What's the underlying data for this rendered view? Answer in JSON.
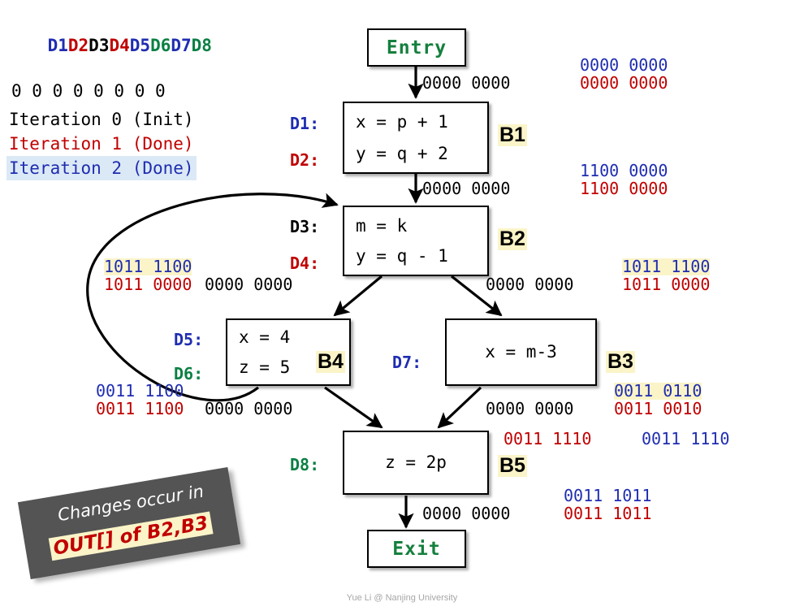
{
  "legend": {
    "definitions": [
      {
        "label": "D1",
        "color": "#1f2db0"
      },
      {
        "label": "D2",
        "color": "#c00000"
      },
      {
        "label": "D3",
        "color": "#000000"
      },
      {
        "label": "D4",
        "color": "#c00000"
      },
      {
        "label": "D5",
        "color": "#1f2db0"
      },
      {
        "label": "D6",
        "color": "#0a8043"
      },
      {
        "label": "D7",
        "color": "#1f2db0"
      },
      {
        "label": "D8",
        "color": "#0a8043"
      }
    ],
    "bits_row": "0 0 0 0 0 0 0 0",
    "iterations": [
      {
        "label": "Iteration 0 (Init)",
        "color": "#000000",
        "highlight": "none"
      },
      {
        "label": "Iteration 1 (Done)",
        "color": "#c00000",
        "highlight": "none"
      },
      {
        "label": "Iteration 2 (Done)",
        "color": "#1f2db0",
        "highlight": "#dbe9f6"
      }
    ]
  },
  "cfg": {
    "entry": {
      "label": "Entry"
    },
    "exit": {
      "label": "Exit"
    },
    "b1": {
      "name": "B1",
      "defs": [
        "D1:",
        "D2:"
      ],
      "stmts": [
        "x = p + 1",
        "y = q + 2"
      ]
    },
    "b2": {
      "name": "B2",
      "defs": [
        "D3:",
        "D4:"
      ],
      "stmts": [
        "m = k",
        "y = q - 1"
      ]
    },
    "b4": {
      "name": "B4",
      "defs": [
        "D5:",
        "D6:"
      ],
      "stmts": [
        "x = 4",
        "z = 5"
      ]
    },
    "b3": {
      "name": "B3",
      "defs": [
        "D7:"
      ],
      "stmts": [
        "x = m-3"
      ]
    },
    "b5": {
      "name": "B5",
      "defs": [
        "D8:"
      ],
      "stmts": [
        "z = 2p"
      ]
    }
  },
  "values": {
    "entry_out_black": "0000 0000",
    "entry_out_blue": "0000 0000",
    "entry_out_red": "0000 0000",
    "b1_out_black": "0000 0000",
    "b1_out_blue": "1100 0000",
    "b1_out_red": "1100 0000",
    "b2_in_left_blue": "1011 1100",
    "b2_in_left_red": "1011 0000",
    "b2_out_left_black": "0000 0000",
    "b2_out_right_black": "0000 0000",
    "b2_out_right_blue": "1011 1100",
    "b2_out_right_red": "1011 0000",
    "b4_out_blue": "0011 1100",
    "b4_out_red": "0011 1100",
    "b4_out_black": "0000 0000",
    "b3_out_black": "0000 0000",
    "b3_out_blue": "0011 0110",
    "b3_out_red": "0011 0010",
    "b5_in_red": "0011 1110",
    "b5_in_blue": "0011 1110",
    "b5_out_black": "0000 0000",
    "b5_out_blue": "0011 1011",
    "b5_out_red": "0011 1011"
  },
  "banner": {
    "line1": "Changes occur in",
    "line2": "OUT[] of B2,B3"
  },
  "footer": {
    "text": "Yue Li @ Nanjing University"
  }
}
